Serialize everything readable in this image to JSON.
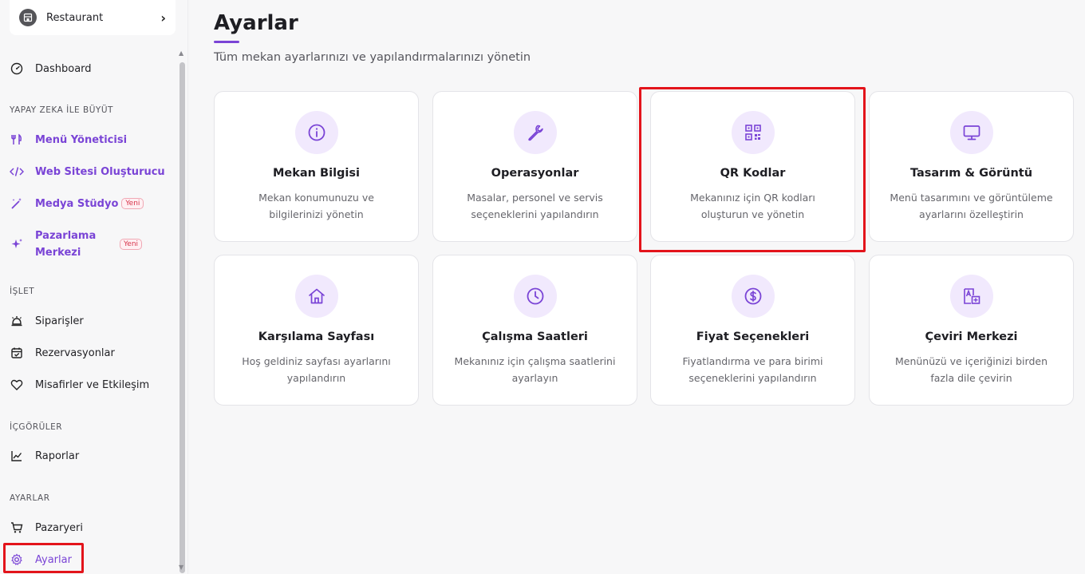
{
  "venue": {
    "name": "Restaurant",
    "chevron": "›",
    "icon": "store-icon"
  },
  "sidebar": {
    "dashboard": "Dashboard",
    "sections": {
      "ai": "YAPAY ZEKA İLE BÜYÜT",
      "operate": "İŞLET",
      "insights": "İÇGÖRÜLER",
      "settings": "AYARLAR"
    },
    "items": {
      "menu_manager": "Menü Yöneticisi",
      "website_builder": "Web Sitesi Oluşturucu",
      "media_studio": "Medya Stüdyo",
      "marketing_line1": "Pazarlama",
      "marketing_line2": "Merkezi",
      "orders": "Siparişler",
      "reservations": "Rezervasyonlar",
      "guests": "Misafirler ve Etkileşim",
      "reports": "Raporlar",
      "marketplace": "Pazaryeri",
      "settings": "Ayarlar"
    },
    "badge_new": "Yeni"
  },
  "page": {
    "title": "Ayarlar",
    "subtitle": "Tüm mekan ayarlarınızı ve yapılandırmalarınızı yönetin"
  },
  "cards": [
    {
      "title": "Mekan Bilgisi",
      "desc": "Mekan konumunuzu ve bilgilerinizi yönetin",
      "icon": "info-icon"
    },
    {
      "title": "Operasyonlar",
      "desc": "Masalar, personel ve servis seçeneklerini yapılandırın",
      "icon": "wrench-icon"
    },
    {
      "title": "QR Kodlar",
      "desc": "Mekanınız için QR kodları oluşturun ve yönetin",
      "icon": "qr-code-icon"
    },
    {
      "title": "Tasarım & Görüntü",
      "desc": "Menü tasarımını ve görüntüleme ayarlarını özelleştirin",
      "icon": "monitor-icon"
    },
    {
      "title": "Karşılama Sayfası",
      "desc": "Hoş geldiniz sayfası ayarlarını yapılandırın",
      "icon": "home-icon"
    },
    {
      "title": "Çalışma Saatleri",
      "desc": "Mekanınız için çalışma saatlerini ayarlayın",
      "icon": "clock-icon"
    },
    {
      "title": "Fiyat Seçenekleri",
      "desc": "Fiyatlandırma ve para birimi seçeneklerini yapılandırın",
      "icon": "dollar-icon"
    },
    {
      "title": "Çeviri Merkezi",
      "desc": "Menünüzü ve içeriğinizi birden fazla dile çevirin",
      "icon": "translate-icon"
    }
  ],
  "colors": {
    "accent": "#7a44d6",
    "highlight": "#e3141b",
    "icon_bg": "#f1e9fd"
  }
}
